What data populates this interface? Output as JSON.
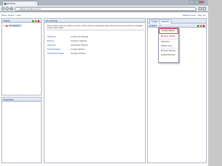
{
  "browser": {
    "tab_title": "RunSuite",
    "tab_close": "×",
    "url": "foobar.runsafturne.com",
    "back": "‹",
    "forward": "›",
    "reload": "↻",
    "star": "☆",
    "min": "–",
    "max": "□",
    "close": "×"
  },
  "appbar": {
    "links": [
      "Save",
      "Project",
      "Help"
    ],
    "sep": "|",
    "right_links": "Welcome user · Sign out"
  },
  "panels": {
    "title": "Panels",
    "tree_arrow": "▾",
    "tree_item": "Hi Learning",
    "splitter": "···"
  },
  "properties": {
    "title": "Properties"
  },
  "center": {
    "title": "Hi Learning",
    "description": "Panel contains schemes, gestures, buttons, number panels and landscape pages. Below list of the items items for navigation between panel states.",
    "rows": [
      {
        "name": "Schemes",
        "value": "0 schemes defined"
      },
      {
        "name": "Buttons",
        "value": "0 buttons defined"
      },
      {
        "name": "Gestures",
        "value": "0 gestures defined"
      },
      {
        "name": "Portrait Pages",
        "value": "1 page defined"
      },
      {
        "name": "Landscape Pages",
        "value": "0 pages defined"
      }
    ]
  },
  "right": {
    "tabs": [
      "Images",
      "Devices"
    ],
    "actions_label": "Actions",
    "dropdown_arrow": "▾"
  },
  "menu": {
    "items": [
      "Create device",
      "Remove device",
      "Add color",
      "Delete color",
      "Browse devices",
      "Upload devices"
    ]
  },
  "colors": {
    "accent": "#15428b",
    "link": "#1c4fa3",
    "highlight": "#d63a3a"
  }
}
